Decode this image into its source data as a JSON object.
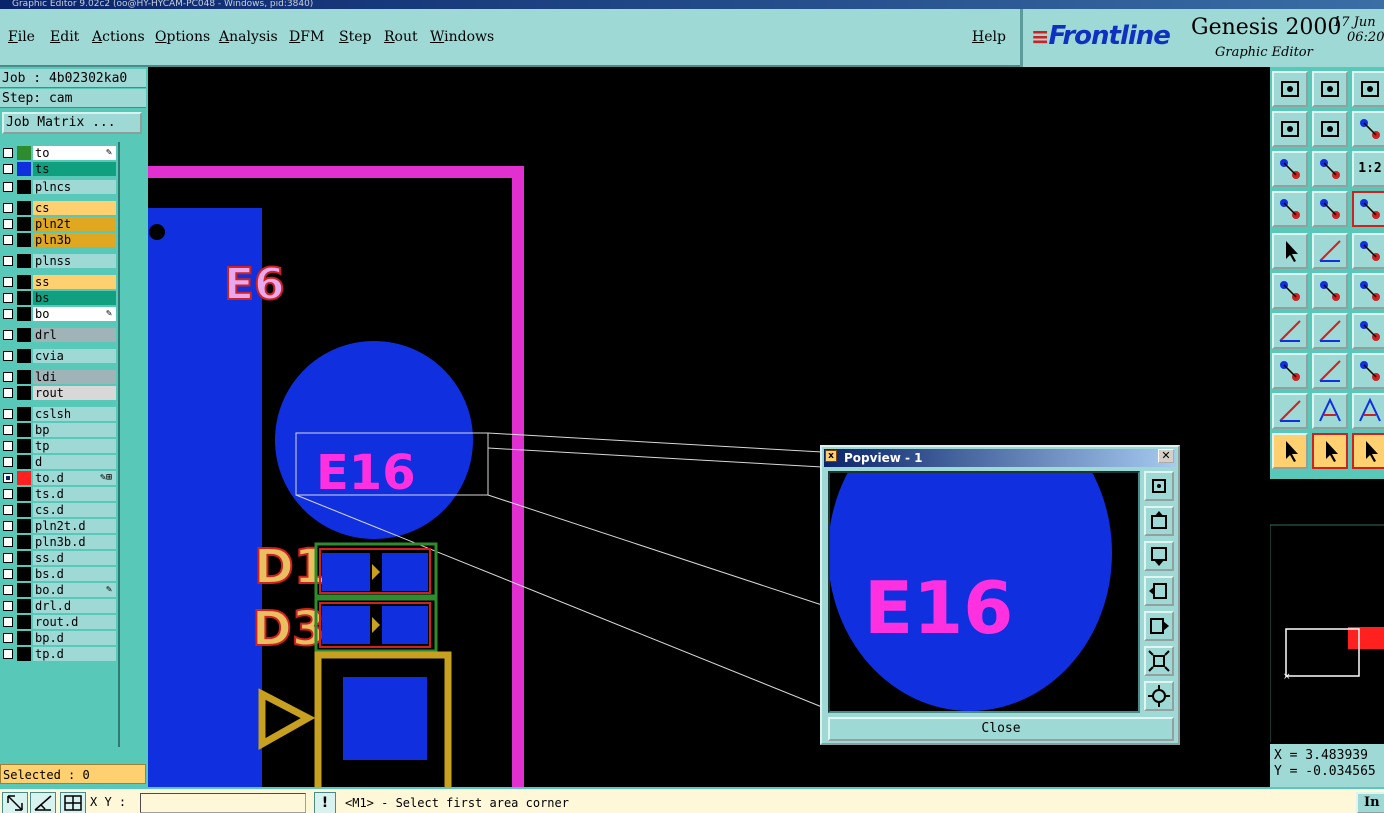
{
  "window": {
    "title": "Graphic Editor 9.02c2 (oo@HY-HYCAM-PC048 - Windows, pid:3840)"
  },
  "menu": {
    "items": [
      {
        "u": "F",
        "rest": "ile"
      },
      {
        "u": "E",
        "rest": "dit"
      },
      {
        "u": "A",
        "rest": "ctions"
      },
      {
        "u": "O",
        "rest": "ptions"
      },
      {
        "u": "A",
        "rest": "nalysis"
      },
      {
        "u": "D",
        "rest": "FM"
      },
      {
        "u": "S",
        "rest": "tep"
      },
      {
        "u": "R",
        "rest": "out"
      },
      {
        "u": "W",
        "rest": "indows"
      },
      {
        "u": "H",
        "rest": "elp"
      }
    ]
  },
  "brand": {
    "logo_prefix": "Fr",
    "logo_rest": "ontline",
    "product": "Genesis 2000",
    "subtitle": "Graphic Editor",
    "date_line1": "17 Jun",
    "date_line2": "06:20"
  },
  "job": {
    "job_label": "Job : 4b02302ka0",
    "step_label": "Step: cam",
    "matrix_button": "Job Matrix ..."
  },
  "layers": [
    {
      "name": "to",
      "bg": "#ffffff",
      "color": "#2e8b2e",
      "mark": "✎"
    },
    {
      "name": "ts",
      "bg": "#10a080",
      "color": "#1030e0",
      "mark": ""
    },
    {
      "name": "plncs",
      "bg": "#9ed9d6",
      "color": "",
      "mark": ""
    },
    {
      "name": "cs",
      "bg": "#ffd070",
      "color": "",
      "mark": ""
    },
    {
      "name": "pln2t",
      "bg": "#e0a820",
      "color": "",
      "mark": ""
    },
    {
      "name": "pln3b",
      "bg": "#e0a820",
      "color": "",
      "mark": ""
    },
    {
      "name": "plnss",
      "bg": "#9ed9d6",
      "color": "",
      "mark": ""
    },
    {
      "name": "ss",
      "bg": "#ffd070",
      "color": "",
      "mark": ""
    },
    {
      "name": "bs",
      "bg": "#10a080",
      "color": "",
      "mark": ""
    },
    {
      "name": "bo",
      "bg": "#ffffff",
      "color": "",
      "mark": "✎"
    },
    {
      "name": "drl",
      "bg": "#a0b4b8",
      "color": "",
      "mark": ""
    },
    {
      "name": "cvia",
      "bg": "#9ed9d6",
      "color": "",
      "mark": ""
    },
    {
      "name": "ldi",
      "bg": "#a0b4b8",
      "color": "",
      "mark": ""
    },
    {
      "name": "rout",
      "bg": "#d8d8d8",
      "color": "",
      "mark": ""
    },
    {
      "name": "cslsh",
      "bg": "#9ed9d6",
      "color": "",
      "mark": ""
    },
    {
      "name": "bp",
      "bg": "#9ed9d6",
      "color": "",
      "mark": ""
    },
    {
      "name": "tp",
      "bg": "#9ed9d6",
      "color": "",
      "mark": ""
    },
    {
      "name": "d",
      "bg": "#9ed9d6",
      "color": "",
      "mark": ""
    },
    {
      "name": "to.d",
      "bg": "#9ed9d6",
      "color": "#ff2020",
      "mark": "✎⊞"
    },
    {
      "name": "ts.d",
      "bg": "#9ed9d6",
      "color": "",
      "mark": ""
    },
    {
      "name": "cs.d",
      "bg": "#9ed9d6",
      "color": "",
      "mark": ""
    },
    {
      "name": "pln2t.d",
      "bg": "#9ed9d6",
      "color": "",
      "mark": ""
    },
    {
      "name": "pln3b.d",
      "bg": "#9ed9d6",
      "color": "",
      "mark": ""
    },
    {
      "name": "ss.d",
      "bg": "#9ed9d6",
      "color": "",
      "mark": ""
    },
    {
      "name": "bs.d",
      "bg": "#9ed9d6",
      "color": "",
      "mark": ""
    },
    {
      "name": "bo.d",
      "bg": "#9ed9d6",
      "color": "",
      "mark": "✎"
    },
    {
      "name": "drl.d",
      "bg": "#9ed9d6",
      "color": "",
      "mark": ""
    },
    {
      "name": "rout.d",
      "bg": "#9ed9d6",
      "color": "",
      "mark": ""
    },
    {
      "name": "bp.d",
      "bg": "#9ed9d6",
      "color": "",
      "mark": ""
    },
    {
      "name": "tp.d",
      "bg": "#9ed9d6",
      "color": "",
      "mark": ""
    }
  ],
  "selected": "Selected : 0",
  "canvas": {
    "labels": {
      "e6": "E6",
      "e16": "E16",
      "d1": "D1",
      "d3": "D3"
    }
  },
  "popview": {
    "title": "Popview - 1",
    "close_button": "Close",
    "close_x": "✕",
    "label": "E16"
  },
  "coords": {
    "x": "X = 3.483939",
    "y": "Y = -0.034565"
  },
  "status": {
    "xy_label": "X Y :",
    "xy_value": "",
    "message": "<M1> - Select first area corner",
    "info_button": "In"
  },
  "colors": {
    "pad_blue": "#1030e0",
    "outline_magenta": "#e030d0",
    "silk_yellow": "#c8a020",
    "trace_green": "#2e8b2e",
    "drill_red": "#ff2020"
  }
}
